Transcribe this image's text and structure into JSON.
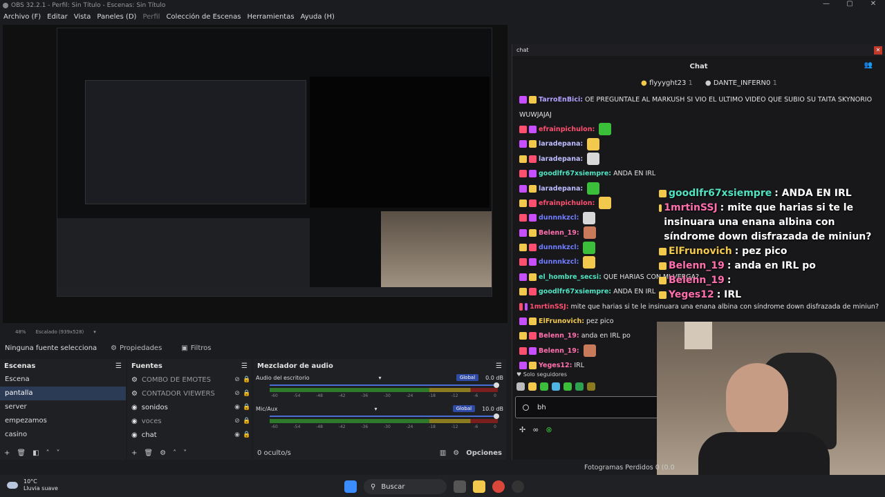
{
  "window": {
    "title": "OBS 32.2.1 - Perfil: Sin Título - Escenas: Sin Título"
  },
  "menu": {
    "items": [
      "Archivo (F)",
      "Editar",
      "Vista",
      "Paneles (D)",
      "Perfil",
      "Colección de Escenas",
      "Herramientas",
      "Ayuda (H)"
    ]
  },
  "zoom": {
    "percent": "48%",
    "scaled": "Escalado (939x528)"
  },
  "source_bar": {
    "no_source": "Ninguna fuente seleccionad",
    "properties": "Propiedades",
    "filters": "Filtros"
  },
  "scenes": {
    "title": "Escenas",
    "items": [
      "Escena",
      "pantalla",
      "server",
      "empezamos",
      "casino"
    ],
    "selected": "pantalla"
  },
  "sources": {
    "title": "Fuentes",
    "items": [
      {
        "label": "COMBO DE EMOTES",
        "visible": false
      },
      {
        "label": "CONTADOR VIEWERS",
        "visible": false
      },
      {
        "label": "sonidos",
        "visible": true
      },
      {
        "label": "voces",
        "visible": false
      },
      {
        "label": "chat",
        "visible": true
      }
    ]
  },
  "mixer": {
    "title": "Mezclador de audio",
    "channels": [
      {
        "name": "Audio del escritorio",
        "badge": "Global",
        "db": "0.0 dB"
      },
      {
        "name": "Mic/Aux",
        "badge": "Global",
        "db": "10.0 dB"
      }
    ],
    "ticks": [
      "-60",
      "-54",
      "-48",
      "-42",
      "-36",
      "-30",
      "-24",
      "-18",
      "-12",
      "-6",
      "0"
    ],
    "hidden": "0 oculto/s",
    "options": "Opciones"
  },
  "chat": {
    "window_title": "chat",
    "header": "Chat",
    "top_chatters": [
      {
        "name": "flyyyght23",
        "count": "1"
      },
      {
        "name": "DANTE_INFERN0",
        "count": "1"
      }
    ],
    "messages": [
      {
        "user": "TarroEnBici",
        "text": "OE PREGUNTALE AL MARKUSH SI VIO EL ULTIMO VIDEO QUE SUBIO SU TAITA SKYNORIO",
        "color": "#b4a0ff"
      },
      {
        "user": "",
        "text": "WUWJAJAJ",
        "color": "#b4a0ff"
      },
      {
        "user": "efrainpichulon",
        "text": "",
        "color": "#ff4f6f"
      },
      {
        "user": "laradepana",
        "text": "",
        "color": "#bdbdff"
      },
      {
        "user": "laradepana",
        "text": "",
        "color": "#bdbdff"
      },
      {
        "user": "goodlfr67xsiempre",
        "text": "ANDA EN IRL",
        "color": "#4fe3c1"
      },
      {
        "user": "laradepana",
        "text": "",
        "color": "#bdbdff"
      },
      {
        "user": "efrainpichulon",
        "text": "",
        "color": "#ff4f6f"
      },
      {
        "user": "dunnnkzcl",
        "text": "",
        "color": "#6f7dff"
      },
      {
        "user": "Belenn_19",
        "text": "",
        "color": "#ff6fae"
      },
      {
        "user": "dunnnkzcl",
        "text": "",
        "color": "#6f7dff"
      },
      {
        "user": "dunnnkzcl",
        "text": "",
        "color": "#6f7dff"
      },
      {
        "user": "el_hombre_secsi",
        "text": "QUE HARIAS CON MI VERGA?",
        "color": "#4fe3c1"
      },
      {
        "user": "goodlfr67xsiempre",
        "text": "ANDA EN IRL",
        "color": "#4fe3c1"
      },
      {
        "user": "1mrtinSSJ",
        "text": "mite que harias si te le insinuara una enana albina con síndrome down disfrazada de miniun?",
        "color": "#ff4f6f"
      },
      {
        "user": "ElFrunovich",
        "text": "pez pico",
        "color": "#f2c94c"
      },
      {
        "user": "Belenn_19",
        "text": "anda en IRL po",
        "color": "#ff6fae"
      },
      {
        "user": "Belenn_19",
        "text": "",
        "color": "#ff6fae"
      },
      {
        "user": "Yeges12",
        "text": "IRL",
        "color": "#ff6fae"
      }
    ],
    "followers_only": "Solo seguidores",
    "input_value": "bh",
    "infinity": "∞"
  },
  "overlay": {
    "rows": [
      {
        "user": "goodlfr67xsiempre",
        "text": ": ANDA EN IRL",
        "cls": ""
      },
      {
        "user": "1mrtinSSJ",
        "text": ": mite que harias si te le insinuara una enana albina con síndrome down disfrazada de miniun?",
        "cls": "pink"
      },
      {
        "user": "ElFrunovich",
        "text": ": pez pico",
        "cls": "gold"
      },
      {
        "user": "Belenn_19",
        "text": ": anda en IRL po",
        "cls": "pink"
      },
      {
        "user": "Belenn_19",
        "text": ":",
        "cls": "pink"
      },
      {
        "user": "Yeges12",
        "text": ": IRL",
        "cls": "pink"
      }
    ]
  },
  "status": {
    "dropped": "Fotogramas Perdidos 0 (0.0"
  },
  "taskbar": {
    "temp": "10°C",
    "weather": "Lluvia suave",
    "search": "Buscar"
  }
}
